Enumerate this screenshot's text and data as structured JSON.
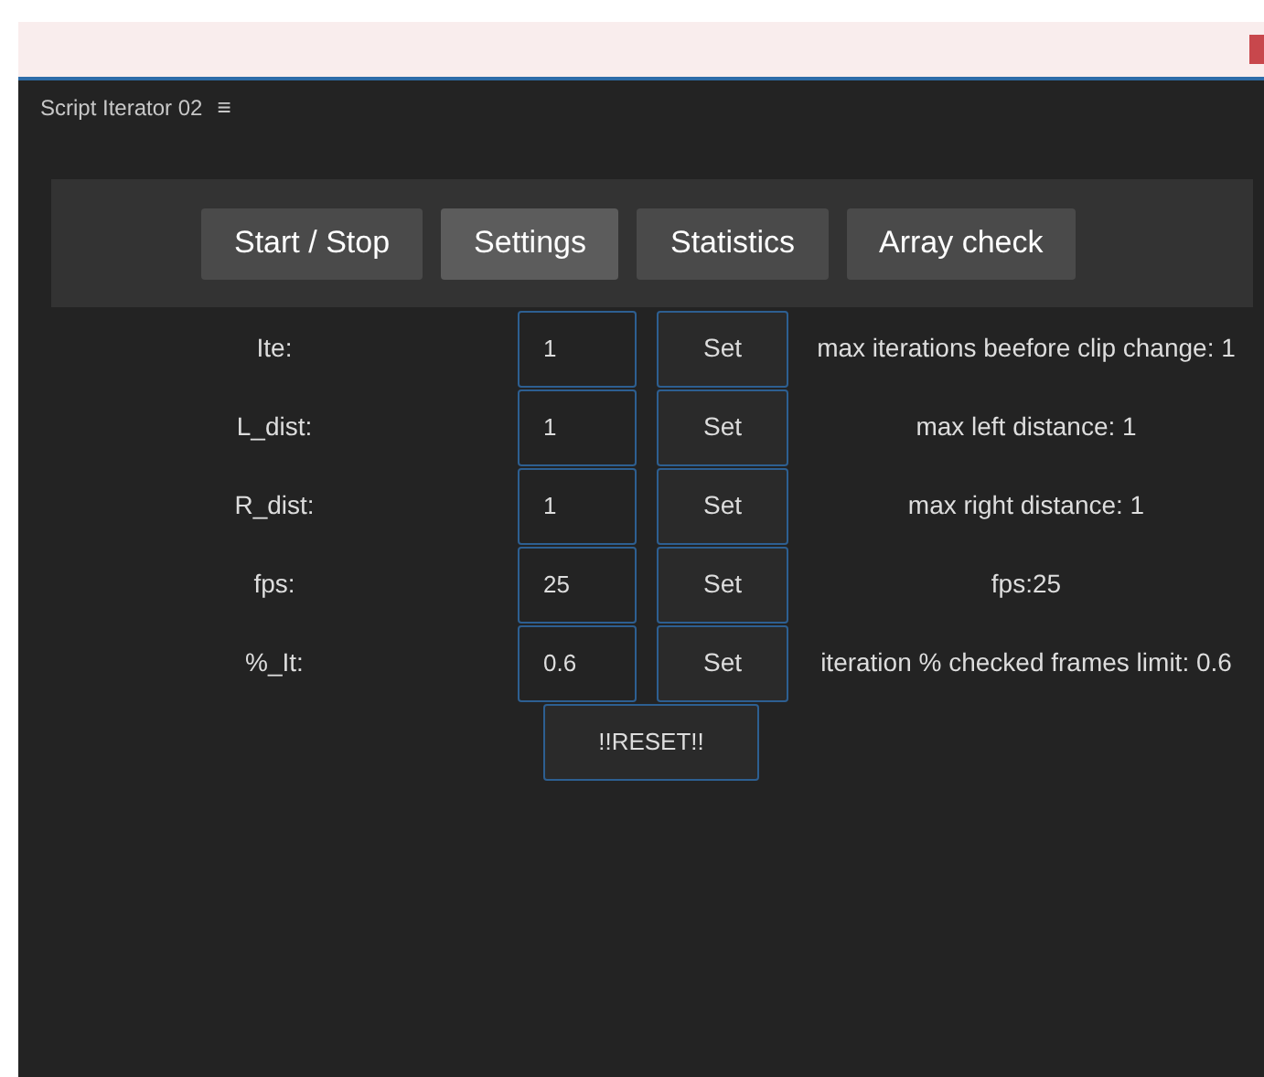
{
  "panel": {
    "title": "Script Iterator 02",
    "menu_glyph": "≡"
  },
  "tabs": [
    {
      "label": "Start / Stop",
      "selected": false
    },
    {
      "label": "Settings",
      "selected": true
    },
    {
      "label": "Statistics",
      "selected": false
    },
    {
      "label": "Array check",
      "selected": false
    }
  ],
  "settings": [
    {
      "label": "Ite:",
      "value": "1",
      "button": "Set",
      "description": "max iterations beefore clip change: 1"
    },
    {
      "label": "L_dist:",
      "value": "1",
      "button": "Set",
      "description": "max left distance: 1"
    },
    {
      "label": "R_dist:",
      "value": "1",
      "button": "Set",
      "description": "max right distance: 1"
    },
    {
      "label": "fps:",
      "value": "25",
      "button": "Set",
      "description": "fps:25"
    },
    {
      "label": "%_It:",
      "value": "0.6",
      "button": "Set",
      "description": "iteration % checked frames limit: 0.6"
    }
  ],
  "reset_button": "!!RESET!!"
}
